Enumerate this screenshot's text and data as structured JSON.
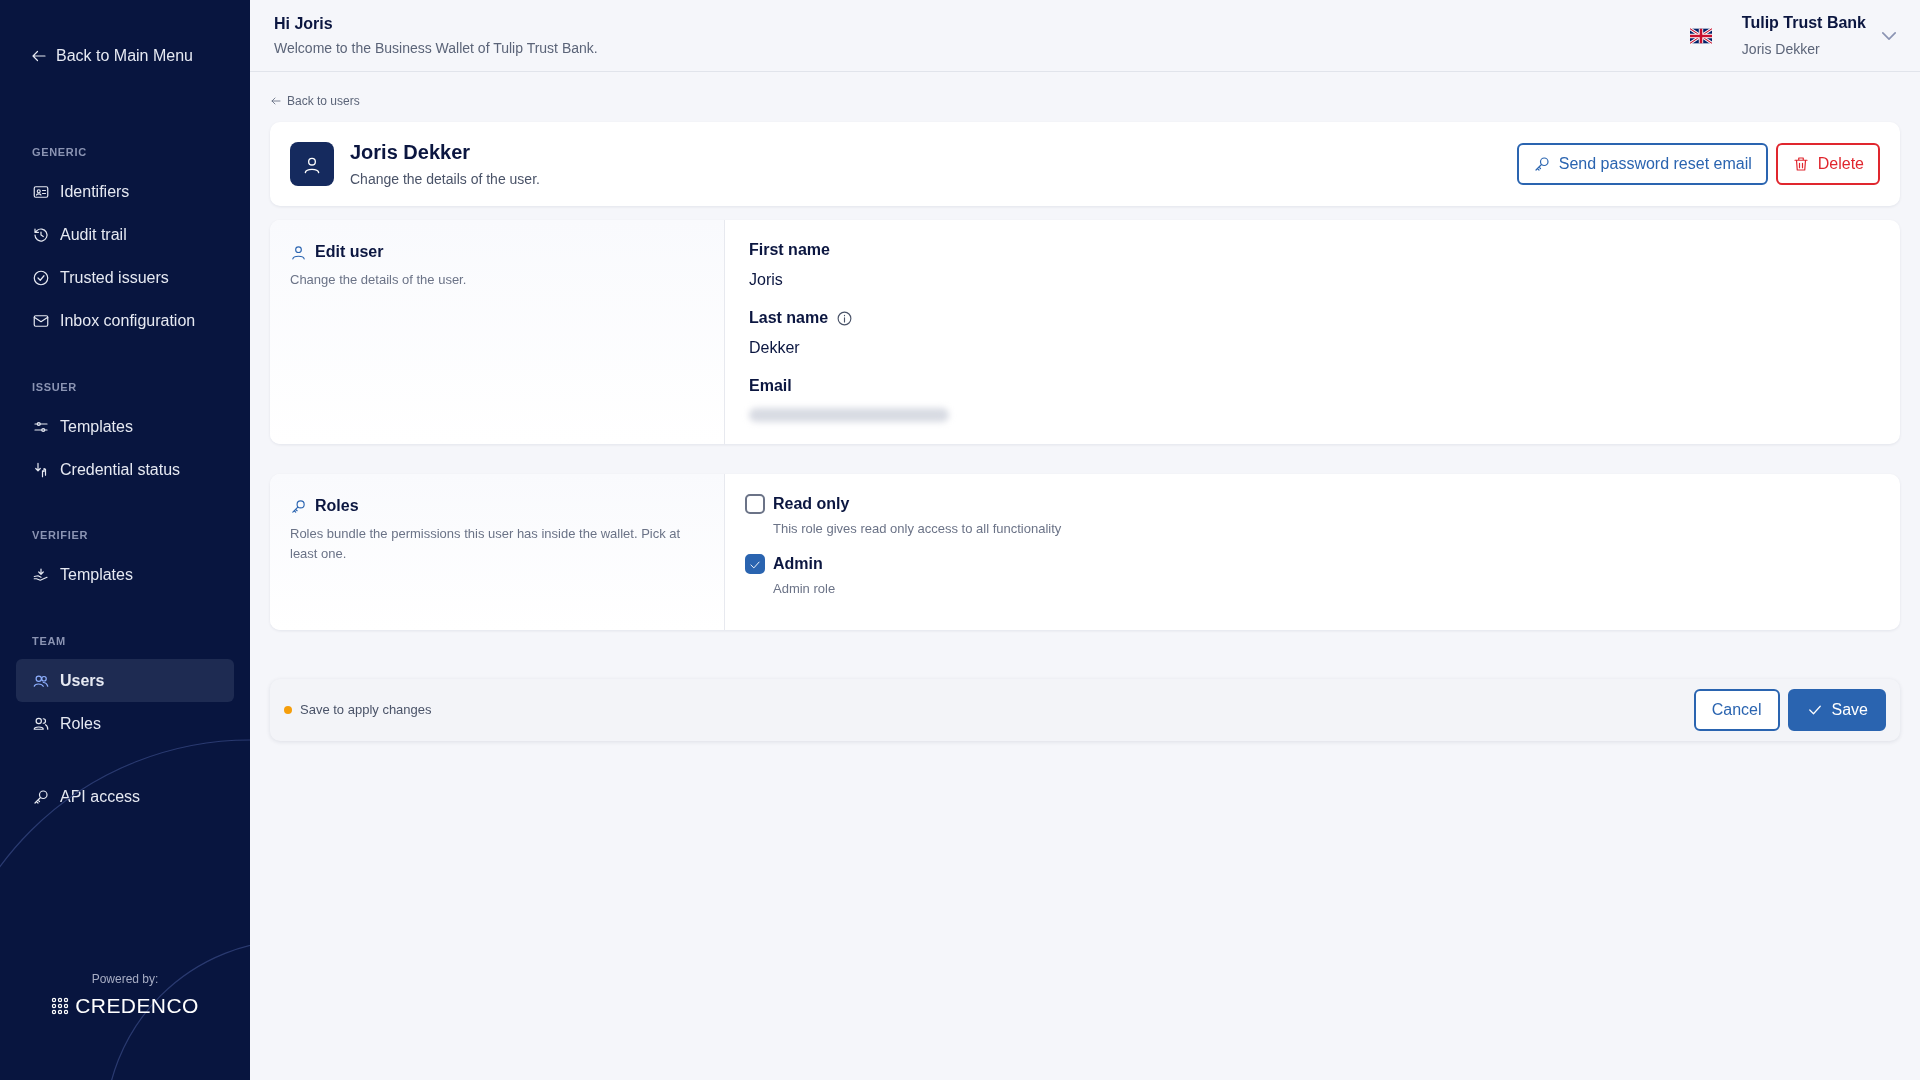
{
  "sidebar": {
    "back": "Back to Main Menu",
    "groups": [
      {
        "heading": "GENERIC",
        "items": [
          {
            "label": "Identifiers",
            "selected": false
          },
          {
            "label": "Audit trail",
            "selected": false
          },
          {
            "label": "Trusted issuers",
            "selected": false
          },
          {
            "label": "Inbox configuration",
            "selected": false
          }
        ]
      },
      {
        "heading": "ISSUER",
        "items": [
          {
            "label": "Templates",
            "selected": false
          },
          {
            "label": "Credential status",
            "selected": false
          }
        ]
      },
      {
        "heading": "VERIFIER",
        "items": [
          {
            "label": "Templates",
            "selected": false
          }
        ]
      },
      {
        "heading": "TEAM",
        "items": [
          {
            "label": "Users",
            "selected": true
          },
          {
            "label": "Roles",
            "selected": false
          }
        ]
      },
      {
        "items": [
          {
            "label": "API access",
            "selected": false
          }
        ]
      }
    ],
    "powered_by": "Powered by:",
    "brand": "CREDENCO"
  },
  "header": {
    "greeting": "Hi Joris",
    "welcome": "Welcome to the Business Wallet of Tulip Trust Bank.",
    "organization": "Tulip Trust Bank",
    "user": "Joris Dekker"
  },
  "back_link": "Back to users",
  "user_card": {
    "name": "Joris Dekker",
    "subtitle": "Change the details of the user.",
    "buttons": [
      {
        "label": "Send password reset email",
        "kind": "primary"
      },
      {
        "label": "Delete",
        "kind": "danger"
      }
    ]
  },
  "edit_user": {
    "title": "Edit user",
    "description": "Change the details of the user.",
    "fields": [
      {
        "label": "First name",
        "value": "Joris",
        "info": false
      },
      {
        "label": "Last name",
        "value": "Dekker",
        "info": true
      },
      {
        "label": "Email",
        "kind": "redacted",
        "info": false
      }
    ]
  },
  "roles": {
    "title": "Roles",
    "description": "Roles bundle the permissions this user has inside the wallet. Pick at least one.",
    "options": [
      {
        "label": "Read only",
        "description": "This role gives read only access to all functionality",
        "checked": false
      },
      {
        "label": "Admin",
        "description": "Admin role",
        "checked": true
      }
    ]
  },
  "save_bar": {
    "message": "Save to apply changes",
    "color": "#f59e0b",
    "buttons": [
      {
        "label": "Cancel",
        "kind": "outline"
      },
      {
        "label": "Save",
        "kind": "solid"
      }
    ]
  }
}
